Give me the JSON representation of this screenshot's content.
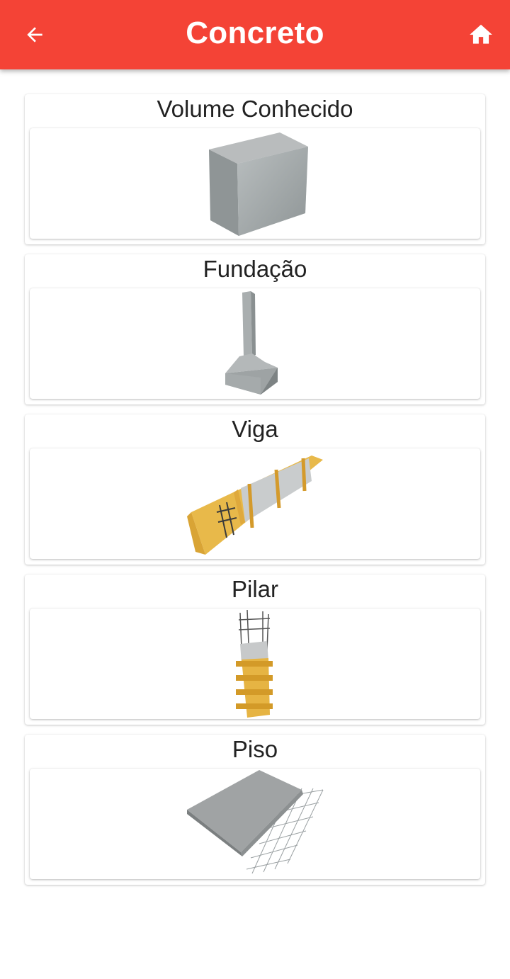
{
  "appbar": {
    "title": "Concreto",
    "back_icon": "arrow-left-icon",
    "home_icon": "home-icon",
    "color": "#f44336"
  },
  "items": [
    {
      "label": "Volume Conhecido",
      "icon": "concrete-block-icon"
    },
    {
      "label": "Fundação",
      "icon": "foundation-footing-icon"
    },
    {
      "label": "Viga",
      "icon": "beam-formwork-icon"
    },
    {
      "label": "Pilar",
      "icon": "pillar-formwork-icon"
    },
    {
      "label": "Piso",
      "icon": "floor-slab-icon"
    }
  ]
}
